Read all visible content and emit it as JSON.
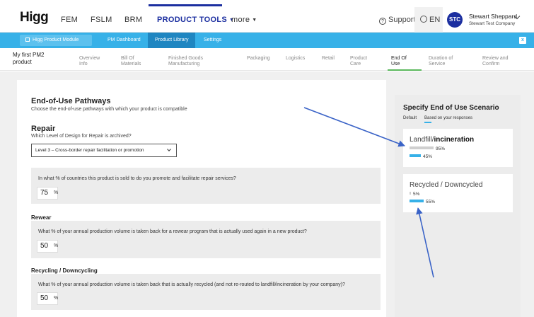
{
  "topnav": {
    "logo": "Higg",
    "items": [
      "FEM",
      "FSLM",
      "BRM",
      "PRODUCT TOOLS",
      "more"
    ],
    "support": "Support",
    "language": "EN",
    "avatar_initials": "STC",
    "user_name": "Stewart Sheppard",
    "user_company": "Stewart Test Company"
  },
  "module_bar": {
    "module_name": "Higg Product Module",
    "links": [
      "PM Dashboard",
      "Product Library",
      "Settings"
    ]
  },
  "steps": {
    "product_name": "My first PM2 product",
    "items": [
      "Overview Info",
      "Bill Of Materials",
      "Finished Goods Manufacturing",
      "Packaging",
      "Logistics",
      "Retail",
      "Product Care",
      "End Of Use",
      "Duration of Service",
      "Review and Confirm"
    ],
    "active": "End Of Use"
  },
  "form": {
    "title": "End-of-Use Pathways",
    "subtitle": "Choose the end-of-use pathways with which your product is compatible",
    "repair_title": "Repair",
    "repair_question": "Which Level of Design for Repair is archived?",
    "repair_select_value": "Level 3 – Cross-border repair facilitation or promotion",
    "q1_text": "In what % of countries this product is sold to do you promote and facilitate repair services?",
    "q1_value": "75",
    "rewear_title": "Rewear",
    "q2_text": "What % of your annual production volume is taken back for a rewear program that is actually used again in a new product?",
    "q2_value": "50",
    "recycle_title": "Recycling / Downcycling",
    "q3_text": "What % of your annual production volume is taken back that is actually recycled (and not re-routed to landfill/incineration by your company)?",
    "q3_value": "50",
    "unit": "%"
  },
  "scenario": {
    "title": "Specify End of Use Scenario",
    "tabs": [
      "Default",
      "Based on your responses"
    ],
    "cards": [
      {
        "title_prefix": "Landfill/",
        "title_bold": "incineration",
        "default_label": "95%",
        "default_pct": 95,
        "response_label": "45%",
        "response_pct": 45
      },
      {
        "title": "Recycled / Downcycled",
        "default_label": "5%",
        "default_pct": 5,
        "response_label": "55%",
        "response_pct": 55
      }
    ]
  },
  "colors": {
    "brand_blue": "#1c2fa0",
    "module_bar": "#37b1e8",
    "default_bar": "#cfcfcf",
    "response_bar": "#37b1e8",
    "annotation_arrow": "#3a63c7"
  }
}
